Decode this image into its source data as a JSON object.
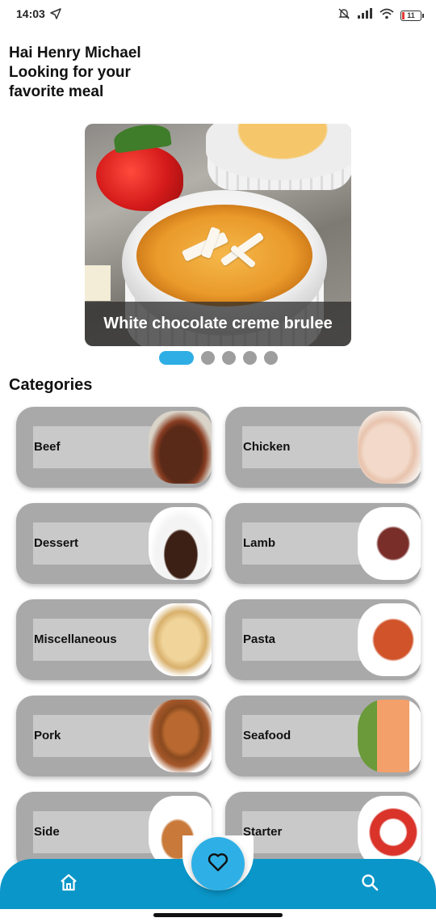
{
  "status_bar": {
    "time": "14:03",
    "battery": "11",
    "icons": [
      "navigation-arrow-icon",
      "bell-muted-icon",
      "signal-icon",
      "wifi-icon",
      "battery-icon"
    ]
  },
  "greeting": {
    "line1": "Hai Henry Michael",
    "line2": "Looking for your",
    "line3": "favorite meal"
  },
  "carousel": {
    "caption": "White chocolate creme brulee",
    "slide_count": 5,
    "active_index": 0
  },
  "categories": {
    "title": "Categories",
    "items": [
      {
        "label": "Beef",
        "image": "beef"
      },
      {
        "label": "Chicken",
        "image": "chicken"
      },
      {
        "label": "Dessert",
        "image": "dessert"
      },
      {
        "label": "Lamb",
        "image": "lamb"
      },
      {
        "label": "Miscellaneous",
        "image": "misc"
      },
      {
        "label": "Pasta",
        "image": "pasta"
      },
      {
        "label": "Pork",
        "image": "pork"
      },
      {
        "label": "Seafood",
        "image": "seafood"
      },
      {
        "label": "Side",
        "image": "side"
      },
      {
        "label": "Starter",
        "image": "starter"
      }
    ]
  },
  "bottom_nav": {
    "items": [
      "home-icon",
      "heart-icon",
      "search-icon"
    ],
    "accent_color": "#0a96c8",
    "fab_color": "#2eb0e6"
  }
}
